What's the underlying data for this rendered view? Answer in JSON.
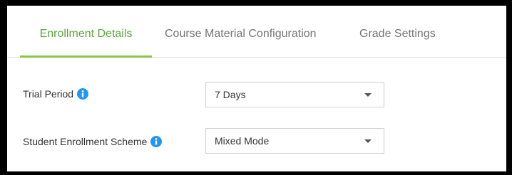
{
  "tabs": [
    {
      "label": "Enrollment Details",
      "active": true
    },
    {
      "label": "Course Material Configuration",
      "active": false
    },
    {
      "label": "Grade Settings",
      "active": false
    }
  ],
  "fields": [
    {
      "label": "Trial Period",
      "info_icon": "info-icon",
      "value": "7 Days"
    },
    {
      "label": "Student Enrollment Scheme",
      "info_icon": "info-icon",
      "value": "Mixed Mode"
    }
  ],
  "colors": {
    "active_tab_text": "#5aa63e",
    "active_tab_underline": "#8bc34a",
    "info_icon": "#2196f3",
    "frame_border": "#000000"
  }
}
